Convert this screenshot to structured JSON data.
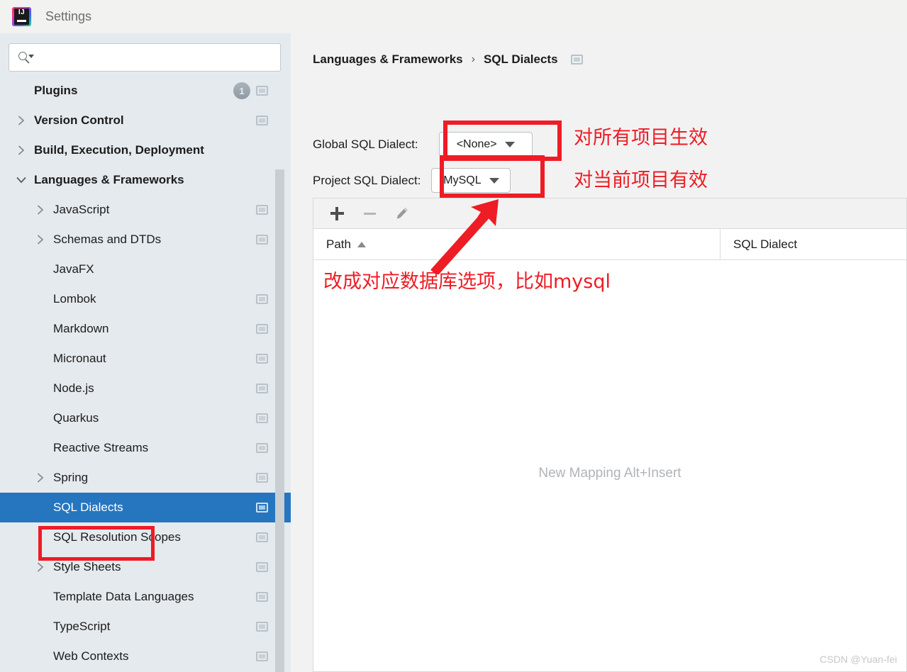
{
  "window": {
    "title": "Settings",
    "logo_icon": "intellij-idea-logo",
    "logo_text": "IJ"
  },
  "search": {
    "placeholder": "",
    "value": "",
    "icon": "search-icon"
  },
  "sidebar": {
    "items": [
      {
        "label": "Plugins",
        "level": 0,
        "bold": true,
        "chevron": "none",
        "badge": "1",
        "scope_icon": true,
        "selected": false
      },
      {
        "label": "Version Control",
        "level": 0,
        "bold": true,
        "chevron": "right",
        "scope_icon": true,
        "selected": false
      },
      {
        "label": "Build, Execution, Deployment",
        "level": 0,
        "bold": true,
        "chevron": "right",
        "scope_icon": false,
        "selected": false
      },
      {
        "label": "Languages & Frameworks",
        "level": 0,
        "bold": true,
        "chevron": "down",
        "scope_icon": false,
        "selected": false
      },
      {
        "label": "JavaScript",
        "level": 1,
        "bold": false,
        "chevron": "right",
        "scope_icon": true,
        "selected": false
      },
      {
        "label": "Schemas and DTDs",
        "level": 1,
        "bold": false,
        "chevron": "right",
        "scope_icon": true,
        "selected": false
      },
      {
        "label": "JavaFX",
        "level": 1,
        "bold": false,
        "chevron": "none",
        "scope_icon": false,
        "selected": false
      },
      {
        "label": "Lombok",
        "level": 1,
        "bold": false,
        "chevron": "none",
        "scope_icon": true,
        "selected": false
      },
      {
        "label": "Markdown",
        "level": 1,
        "bold": false,
        "chevron": "none",
        "scope_icon": true,
        "selected": false
      },
      {
        "label": "Micronaut",
        "level": 1,
        "bold": false,
        "chevron": "none",
        "scope_icon": true,
        "selected": false
      },
      {
        "label": "Node.js",
        "level": 1,
        "bold": false,
        "chevron": "none",
        "scope_icon": true,
        "selected": false
      },
      {
        "label": "Quarkus",
        "level": 1,
        "bold": false,
        "chevron": "none",
        "scope_icon": true,
        "selected": false
      },
      {
        "label": "Reactive Streams",
        "level": 1,
        "bold": false,
        "chevron": "none",
        "scope_icon": true,
        "selected": false
      },
      {
        "label": "Spring",
        "level": 1,
        "bold": false,
        "chevron": "right",
        "scope_icon": true,
        "selected": false
      },
      {
        "label": "SQL Dialects",
        "level": 1,
        "bold": false,
        "chevron": "none",
        "scope_icon": true,
        "selected": true
      },
      {
        "label": "SQL Resolution Scopes",
        "level": 1,
        "bold": false,
        "chevron": "none",
        "scope_icon": true,
        "selected": false
      },
      {
        "label": "Style Sheets",
        "level": 1,
        "bold": false,
        "chevron": "right",
        "scope_icon": true,
        "selected": false
      },
      {
        "label": "Template Data Languages",
        "level": 1,
        "bold": false,
        "chevron": "none",
        "scope_icon": true,
        "selected": false
      },
      {
        "label": "TypeScript",
        "level": 1,
        "bold": false,
        "chevron": "none",
        "scope_icon": true,
        "selected": false
      },
      {
        "label": "Web Contexts",
        "level": 1,
        "bold": false,
        "chevron": "none",
        "scope_icon": true,
        "selected": false
      }
    ]
  },
  "main": {
    "breadcrumb": {
      "parent": "Languages & Frameworks",
      "separator": "›",
      "current": "SQL Dialects",
      "scope_icon": "project-scope-icon"
    },
    "global_dialect": {
      "label": "Global SQL Dialect:",
      "value": "<None>",
      "caret_icon": "chevron-down-icon"
    },
    "project_dialect": {
      "label": "Project SQL Dialect:",
      "value": "MySQL",
      "caret_icon": "chevron-down-icon"
    },
    "toolbar": {
      "add_icon": "plus-icon",
      "remove_icon": "minus-icon",
      "edit_icon": "pencil-icon"
    },
    "table": {
      "columns": [
        "Path",
        "SQL Dialect"
      ],
      "sort_column": "Path",
      "sort_direction": "ascending",
      "rows": [],
      "empty_text": "New Mapping Alt+Insert"
    }
  },
  "annotations": {
    "global_note": "对所有项目生效",
    "project_note": "对当前项目有效",
    "bottom_note": "改成对应数据库选项，比如mysql",
    "color": "#ee1c25",
    "arrow_icon": "red-arrow-up-right"
  },
  "watermark": "CSDN @Yuan-fei"
}
